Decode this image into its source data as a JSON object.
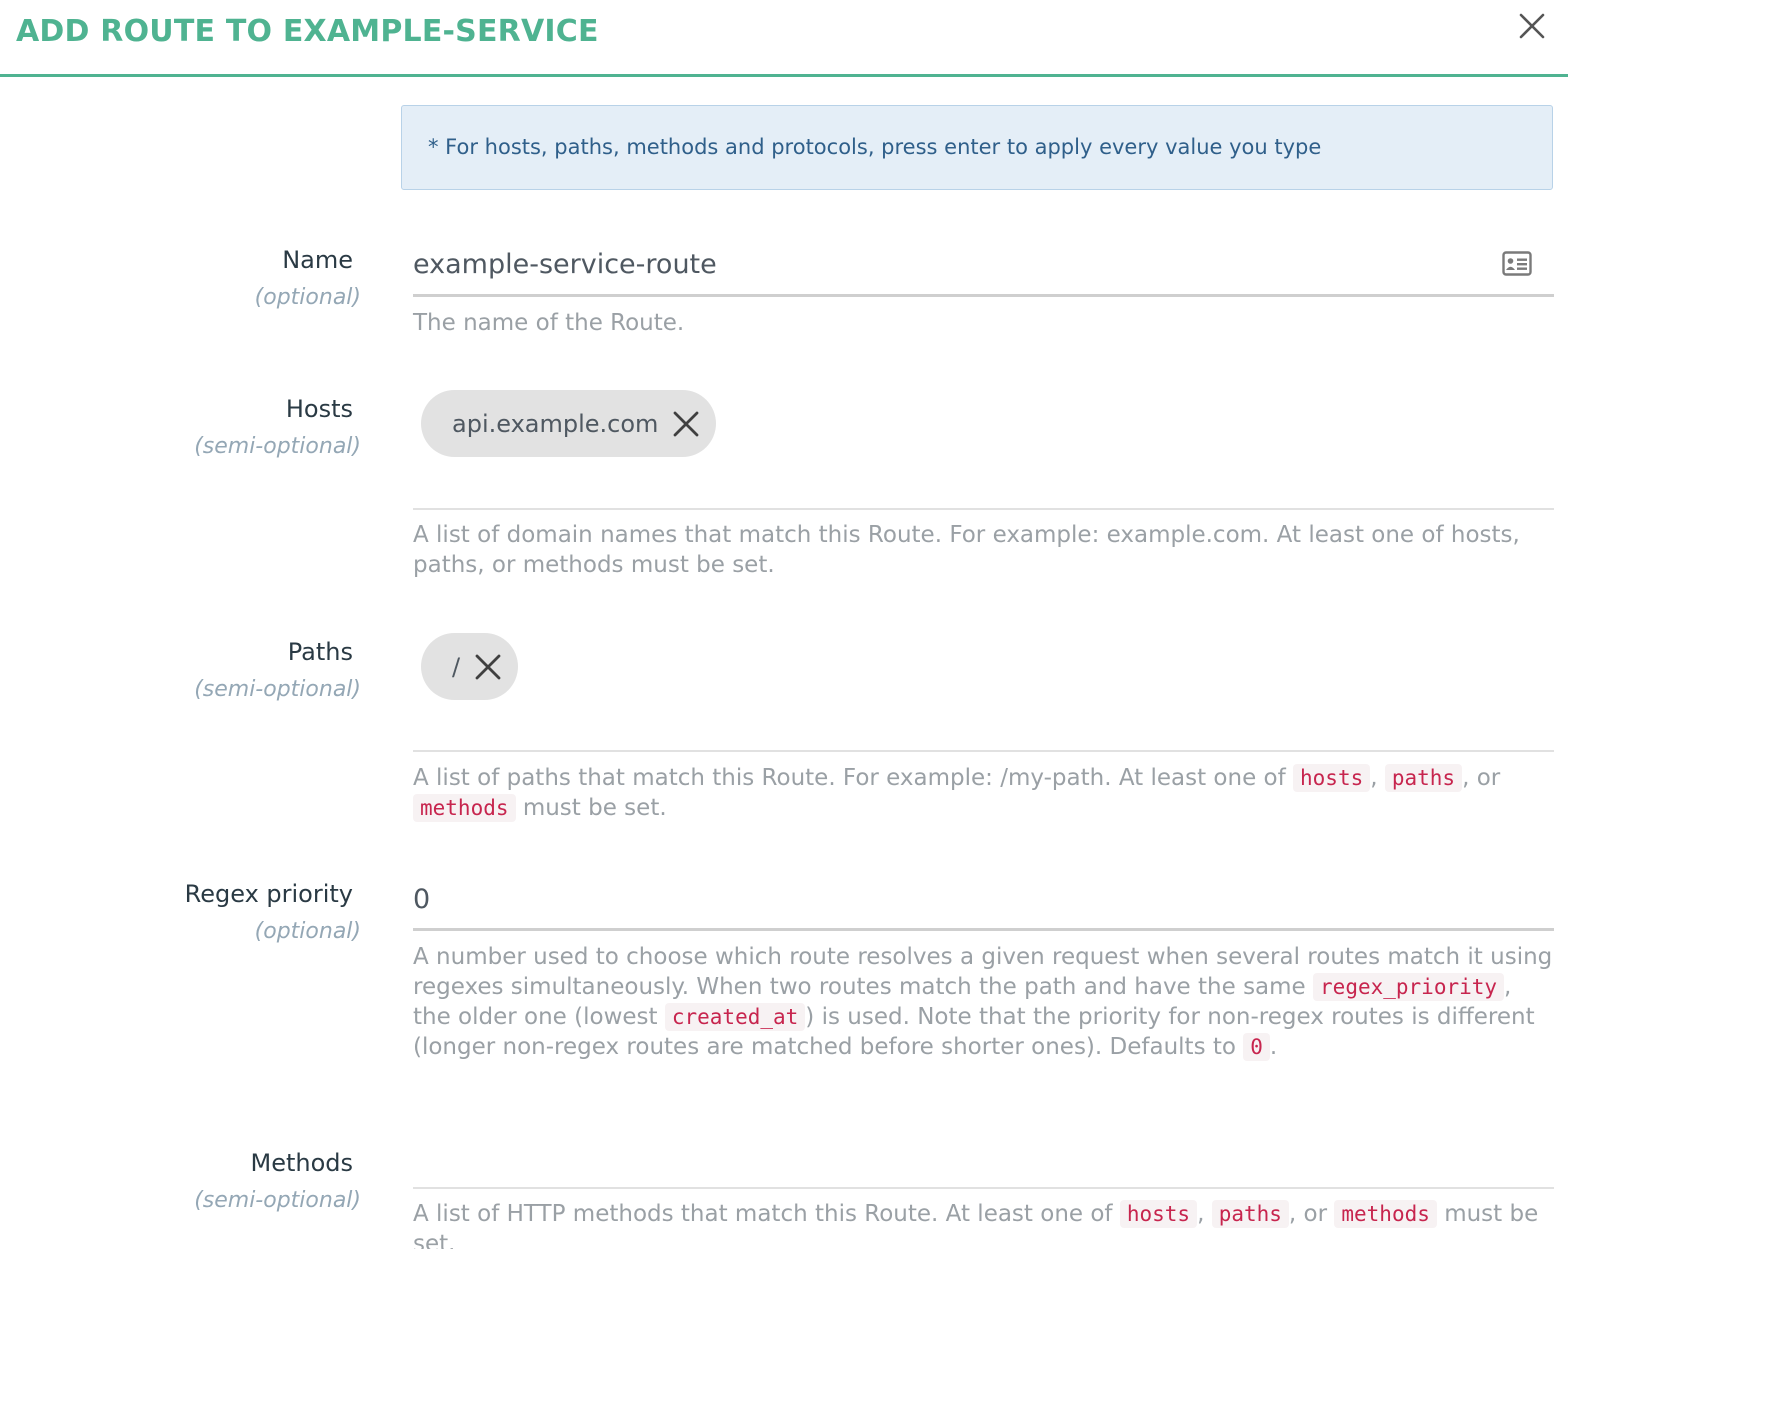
{
  "modal": {
    "title": "ADD ROUTE TO EXAMPLE-SERVICE",
    "close_icon": "close-icon",
    "accent_color": "#4fb391"
  },
  "info": {
    "text": "* For hosts, paths, methods and protocols, press enter to apply every value you type"
  },
  "fields": {
    "name": {
      "label": "Name",
      "sub": "(optional)",
      "value": "example-service-route",
      "icon": "contact-card-icon",
      "help": "The name of the Route."
    },
    "hosts": {
      "label": "Hosts",
      "sub": "(semi-optional)",
      "tags": [
        "api.example.com"
      ],
      "help": "A list of domain names that match this Route. For example: example.com. At least one of hosts, paths, or methods must be set."
    },
    "paths": {
      "label": "Paths",
      "sub": "(semi-optional)",
      "tags": [
        "/"
      ],
      "help_parts": {
        "p1": "A list of paths that match this Route. For example: /my-path. At least one of ",
        "c1": "hosts",
        "p2": ", ",
        "c2": "paths",
        "p3": ", or ",
        "c3": "methods",
        "p4": " must be set."
      }
    },
    "regex_priority": {
      "label": "Regex priority",
      "sub": "(optional)",
      "value": "0",
      "help_parts": {
        "p1": "A number used to choose which route resolves a given request when several routes match it using regexes simultaneously. When two routes match the path and have the same ",
        "c1": "regex_priority",
        "p2": ", the older one (lowest ",
        "c2": "created_at",
        "p3": ") is used. Note that the priority for non-regex routes is different (longer non-regex routes are matched before shorter ones). Defaults to ",
        "c3": "0",
        "p4": "."
      }
    },
    "methods": {
      "label": "Methods",
      "sub": "(semi-optional)",
      "help_parts": {
        "p1": "A list of HTTP methods that match this Route. At least one of ",
        "c1": "hosts",
        "p2": ", ",
        "c2": "paths",
        "p3": ", or ",
        "c3": "methods",
        "p4": " must be set."
      }
    }
  }
}
